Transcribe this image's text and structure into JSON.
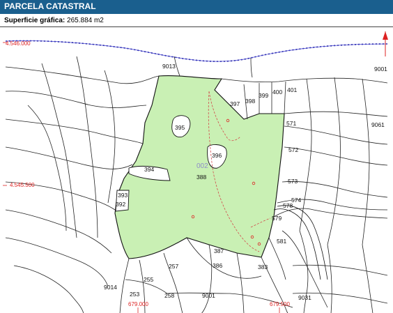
{
  "header": {
    "title": "PARCELA CATASTRAL"
  },
  "surface": {
    "label": "Superficie gráfica:",
    "value": "265.884 m2"
  },
  "map": {
    "polygon_code": "002",
    "highlight_color": "#c9f0b4",
    "coords": {
      "top_left_y": "4.546.000",
      "left_y": "4.545.500",
      "bottom_x1": "679.000",
      "bottom_x2": "679.500"
    },
    "parcels": [
      "9013",
      "9001",
      "397",
      "398",
      "399",
      "400",
      "401",
      "571",
      "9061",
      "395",
      "396",
      "572",
      "394",
      "388",
      "573",
      "393",
      "392",
      "574",
      "578",
      "579",
      "581",
      "387",
      "257",
      "386",
      "383",
      "255",
      "9014",
      "253",
      "258",
      "9001",
      "9031"
    ]
  }
}
